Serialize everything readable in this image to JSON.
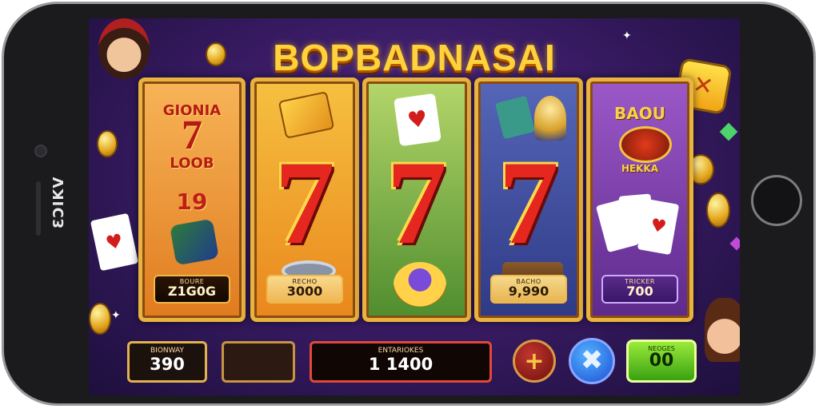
{
  "device": {
    "side_label": "ƐƆIKV"
  },
  "game": {
    "title": "BOPBADNASAI",
    "reels": [
      {
        "top_text_1": "GIONIA",
        "top_text_2": "LOOB",
        "number": "19",
        "symbol": "7",
        "badge_label": "BOURE",
        "badge_value": "Z1G0G"
      },
      {
        "symbol": "7",
        "badge_label": "RECHO",
        "badge_value": "3000"
      },
      {
        "symbol": "7",
        "badge_label": "",
        "badge_value": ""
      },
      {
        "symbol": "7",
        "badge_label": "BACHO",
        "badge_value": "9,990"
      },
      {
        "top_text_1": "BAOU",
        "top_text_2": "HEKKA",
        "badge_label": "TRICKER",
        "badge_value": "700"
      }
    ]
  },
  "bottom_bar": {
    "balance_label": "BIONWAY",
    "balance_value": "390",
    "win_label": "ENTARIOKES",
    "win_value": "1 1400",
    "plus_label": "+",
    "close_label": "✖",
    "spin_label": "NEOGES",
    "spin_value": "00"
  },
  "colors": {
    "accent_gold": "#ffd23c",
    "seven_red": "#e62720",
    "spin_green": "#5ac41e",
    "close_blue": "#2b6cf0",
    "frame_gold": "#e9b340"
  }
}
